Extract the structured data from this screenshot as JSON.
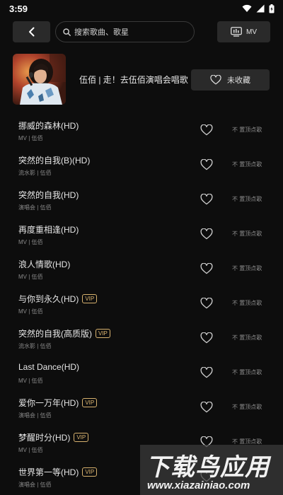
{
  "status_bar": {
    "time": "3:59"
  },
  "topbar": {
    "back_icon": "chevron-left-icon",
    "search_placeholder": "搜索歌曲、歌星",
    "mv_label": "MV"
  },
  "album": {
    "title": "伍佰 | 走！去伍佰演唱会唱歌",
    "favorite_label": "未收藏"
  },
  "songs": [
    {
      "title": "挪威的森林(HD)",
      "vip": false,
      "meta": "MV | 伍佰",
      "action": "不 置顶点歌"
    },
    {
      "title": "突然的自我(B)(HD)",
      "vip": false,
      "meta": "流水影 | 伍佰",
      "action": "不 置顶点歌"
    },
    {
      "title": "突然的自我(HD)",
      "vip": false,
      "meta": "演唱会 | 伍佰",
      "action": "不 置顶点歌"
    },
    {
      "title": "再度重相逢(HD)",
      "vip": false,
      "meta": "MV | 伍佰",
      "action": "不 置顶点歌"
    },
    {
      "title": "浪人情歌(HD)",
      "vip": false,
      "meta": "MV | 伍佰",
      "action": "不 置顶点歌"
    },
    {
      "title": "与你到永久(HD)",
      "vip": true,
      "meta": "MV | 伍佰",
      "action": "不 置顶点歌"
    },
    {
      "title": "突然的自我(高质版)",
      "vip": true,
      "meta": "流水影 | 伍佰",
      "action": "不 置顶点歌"
    },
    {
      "title": "Last Dance(HD)",
      "vip": false,
      "meta": "MV | 伍佰",
      "action": "不 置顶点歌"
    },
    {
      "title": "爱你一万年(HD)",
      "vip": true,
      "meta": "演唱会 | 伍佰",
      "action": "不 置顶点歌"
    },
    {
      "title": "梦醒时分(HD)",
      "vip": true,
      "meta": "MV | 伍佰",
      "action": "不 置顶点歌"
    },
    {
      "title": "世界第一等(HD)",
      "vip": true,
      "meta": "演唱会 | 伍佰",
      "action": ""
    }
  ],
  "vip_label": "VIP",
  "watermark": {
    "main": "下载鸟应用",
    "url": "www.xiazainiao.com"
  },
  "colors": {
    "background": "#0d0d0d",
    "button": "#2a2a2a",
    "vip": "#d8b26e"
  }
}
